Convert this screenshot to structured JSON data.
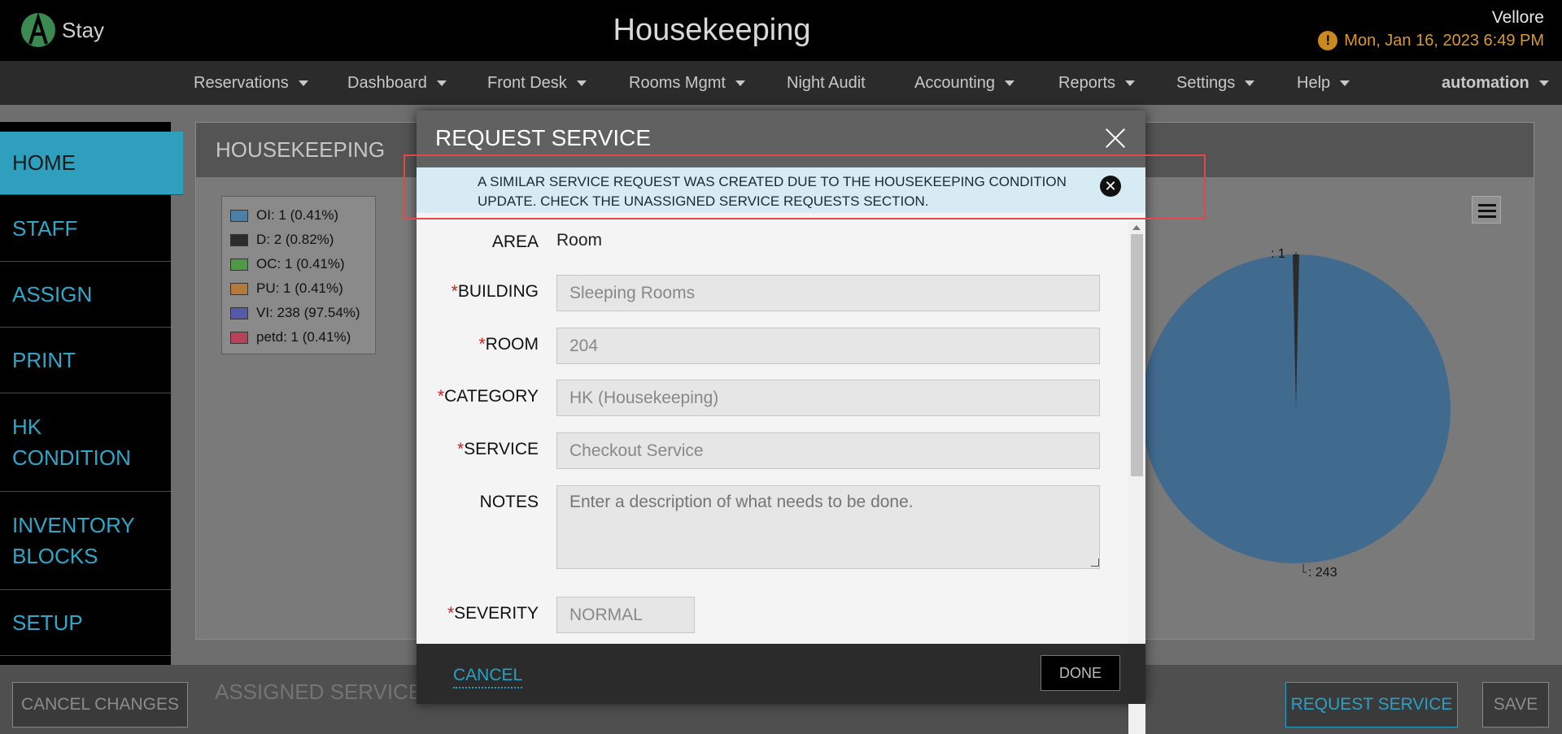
{
  "header": {
    "brand": "Stay",
    "title": "Housekeeping",
    "location": "Vellore",
    "datetime": "Mon, Jan 16, 2023 6:49 PM"
  },
  "nav": {
    "items": [
      "Reservations",
      "Dashboard",
      "Front Desk",
      "Rooms Mgmt",
      "Night Audit",
      "Accounting",
      "Reports",
      "Settings",
      "Help"
    ],
    "user": "automation"
  },
  "sidebar": {
    "items": [
      "HOME",
      "STAFF",
      "ASSIGN",
      "PRINT",
      "HK CONDITION",
      "INVENTORY BLOCKS",
      "SETUP"
    ],
    "active": "HOME"
  },
  "panel": {
    "title": "HOUSEKEEPING",
    "legend": [
      {
        "label": "OI: 1 (0.41%)",
        "color": "#4a7fa8"
      },
      {
        "label": "D: 2 (0.82%)",
        "color": "#2b2b2b"
      },
      {
        "label": "OC: 1 (0.41%)",
        "color": "#4e9a44"
      },
      {
        "label": "PU: 1 (0.41%)",
        "color": "#b5793a"
      },
      {
        "label": "VI: 238 (97.54%)",
        "color": "#5658a8"
      },
      {
        "label": "petd: 1 (0.41%)",
        "color": "#b8425c"
      }
    ],
    "pie_labels": [
      ": 1",
      ": 243"
    ],
    "pie_color": "#416a8f"
  },
  "bottom": {
    "cancel_changes": "CANCEL CHANGES",
    "assigned_title": "ASSIGNED SERVICE",
    "request_service": "REQUEST SERVICE",
    "save": "SAVE"
  },
  "modal": {
    "title": "REQUEST SERVICE",
    "alert": "A SIMILAR SERVICE REQUEST WAS CREATED DUE TO THE HOUSEKEEPING CONDITION UPDATE. CHECK THE UNASSIGNED SERVICE REQUESTS SECTION.",
    "fields": {
      "area_label": "AREA",
      "area_value": "Room",
      "building_label": "BUILDING",
      "building_value": "Sleeping Rooms",
      "room_label": "ROOM",
      "room_value": "204",
      "category_label": "CATEGORY",
      "category_value": "HK (Housekeeping)",
      "service_label": "SERVICE",
      "service_value": "Checkout Service",
      "notes_label": "NOTES",
      "notes_placeholder": "Enter a description of what needs to be done.",
      "severity_label": "SEVERITY",
      "severity_value": "NORMAL"
    },
    "cancel": "CANCEL",
    "done": "DONE"
  }
}
